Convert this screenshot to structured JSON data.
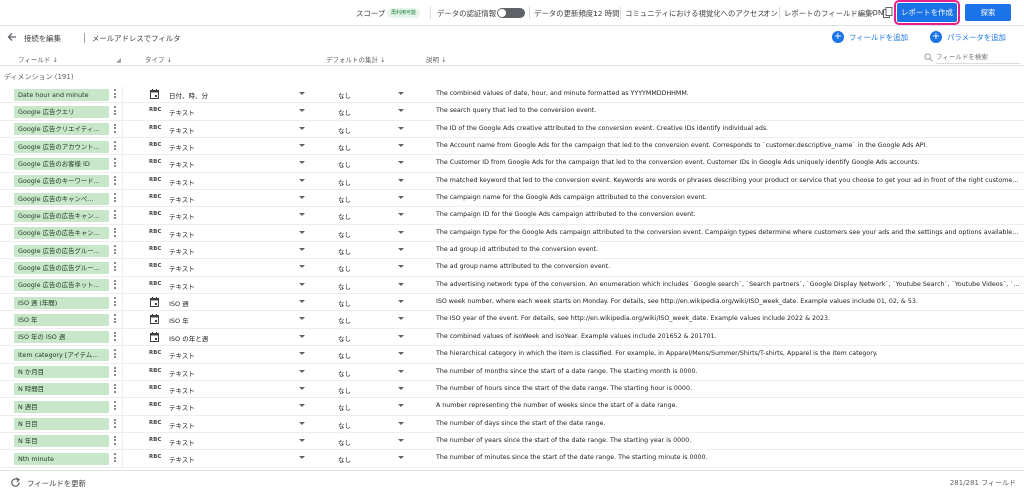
{
  "topbar": {
    "scope_label": "スコープ",
    "scope_badge": "再利用可能",
    "credentials_label": "データの認証情報",
    "freshness_label": "データの更新頻度 :",
    "freshness_value": "12 時間",
    "community_label": "コミュニティにおける視覚化へのアクセス:",
    "community_value": "オン",
    "field_edit_label": "レポートのフィールド編集:",
    "field_edit_value": "ON",
    "create_report_label": "レポートを作成",
    "explore_label": "探索",
    "highlight_color": "#e91e8c",
    "accent_color": "#1a73e8"
  },
  "subbar": {
    "edit_connection_label": "接続を編集",
    "filter_label": "メールアドレスでフィルタ",
    "add_field_label": "フィールドを追加",
    "add_parameter_label": "パラメータを追加"
  },
  "header": {
    "field_col": "フィールド",
    "type_col": "タイプ",
    "default_agg_col": "デフォルトの集計",
    "description_col": "説明",
    "search_placeholder": "フィールドを検索"
  },
  "section": {
    "label": "ディメンション (191)"
  },
  "rows": [
    {
      "name": "Date hour and minute",
      "type_icon": "calendar-icon",
      "type": "日付、時、分",
      "agg": "なし",
      "desc": "The combined values of date, hour, and minute formatted as YYYYMMDDHHMM."
    },
    {
      "name": "Google 広告クエリ",
      "type_icon": "abc",
      "type": "テキスト",
      "agg": "なし",
      "desc": "The search query that led to the conversion event."
    },
    {
      "name": "Google 広告クリエイティ...",
      "type_icon": "abc",
      "type": "テキスト",
      "agg": "なし",
      "desc": "The ID of the Google Ads creative attributed to the conversion event. Creative IDs identify individual ads."
    },
    {
      "name": "Google 広告のアカウント...",
      "type_icon": "abc",
      "type": "テキスト",
      "agg": "なし",
      "desc": "The Account name from Google Ads for the campaign that led to the conversion event. Corresponds to `customer.descriptive_name` in the Google Ads API."
    },
    {
      "name": "Google 広告のお客様 ID",
      "type_icon": "abc",
      "type": "テキスト",
      "agg": "なし",
      "desc": "The Customer ID from Google Ads for the campaign that led to the conversion event. Customer IDs in Google Ads uniquely identify Google Ads accounts."
    },
    {
      "name": "Google 広告のキーワード...",
      "type_icon": "abc",
      "type": "テキスト",
      "agg": "なし",
      "desc": "The matched keyword that led to the conversion event. Keywords are words or phrases describing your product or service that you choose to get your ad in front of the right customers. To learn more ab..."
    },
    {
      "name": "Google 広告のキャンペ...",
      "type_icon": "abc",
      "type": "テキスト",
      "agg": "なし",
      "desc": "The campaign name for the Google Ads campaign attributed to the conversion event."
    },
    {
      "name": "Google 広告の広告キャン...",
      "type_icon": "abc",
      "type": "テキスト",
      "agg": "なし",
      "desc": "The campaign ID for the Google Ads campaign attributed to the conversion event."
    },
    {
      "name": "Google 広告の広告キャン...",
      "type_icon": "abc",
      "type": "テキスト",
      "agg": "なし",
      "desc": "The campaign type for the Google Ads campaign attributed to the conversion event. Campaign types determine where customers see your ads and the settings and options available to you in Google A..."
    },
    {
      "name": "Google 広告の広告グルー...",
      "type_icon": "abc",
      "type": "テキスト",
      "agg": "なし",
      "desc": "The ad group id attributed to the conversion event."
    },
    {
      "name": "Google 広告の広告グルー...",
      "type_icon": "abc",
      "type": "テキスト",
      "agg": "なし",
      "desc": "The ad group name attributed to the conversion event."
    },
    {
      "name": "Google 広告の広告ネット...",
      "type_icon": "abc",
      "type": "テキスト",
      "agg": "なし",
      "desc": "The advertising network type of the conversion. An enumeration which includes `Google search`, `Search partners`, `Google Display Network`, `Youtube Search`, `Youtube Videos`, `Cross-network`, `Soci..."
    },
    {
      "name": "ISO 週 (年間)",
      "type_icon": "calendar-icon",
      "type": "ISO 週",
      "agg": "なし",
      "desc": "ISO week number, where each week starts on Monday. For details, see http://en.wikipedia.org/wiki/ISO_week_date. Example values include 01, 02, & 53."
    },
    {
      "name": "ISO 年",
      "type_icon": "calendar-icon",
      "type": "ISO 年",
      "agg": "なし",
      "desc": "The ISO year of the event. For details, see http://en.wikipedia.org/wiki/ISO_week_date. Example values include 2022 & 2023."
    },
    {
      "name": "ISO 年の ISO 週",
      "type_icon": "calendar-icon",
      "type": "ISO の年と週",
      "agg": "なし",
      "desc": "The combined values of isoWeek and isoYear. Example values include 201652 & 201701."
    },
    {
      "name": "Item category [アイテム...",
      "type_icon": "abc",
      "type": "テキスト",
      "agg": "なし",
      "desc": "The hierarchical category in which the item is classified. For example, in Apparel/Mens/Summer/Shirts/T-shirts, Apparel is the item category."
    },
    {
      "name": "N か月目",
      "type_icon": "abc",
      "type": "テキスト",
      "agg": "なし",
      "desc": "The number of months since the start of a date range. The starting month is 0000."
    },
    {
      "name": "N 時間目",
      "type_icon": "abc",
      "type": "テキスト",
      "agg": "なし",
      "desc": "The number of hours since the start of the date range. The starting hour is 0000."
    },
    {
      "name": "N 週目",
      "type_icon": "abc",
      "type": "テキスト",
      "agg": "なし",
      "desc": "A number representing the number of weeks since the start of a date range."
    },
    {
      "name": "N 日目",
      "type_icon": "abc",
      "type": "テキスト",
      "agg": "なし",
      "desc": "The number of days since the start of the date range."
    },
    {
      "name": "N 年目",
      "type_icon": "abc",
      "type": "テキスト",
      "agg": "なし",
      "desc": "The number of years since the start of the date range. The starting year is 0000."
    },
    {
      "name": "Nth minute",
      "type_icon": "abc",
      "type": "テキスト",
      "agg": "なし",
      "desc": "The number of minutes since the start of the date range. The starting minute is 0000."
    }
  ],
  "abc_glyph": "RBC",
  "footer": {
    "refresh_label": "フィールドを更新",
    "count_label": "281/281 フィールド"
  }
}
